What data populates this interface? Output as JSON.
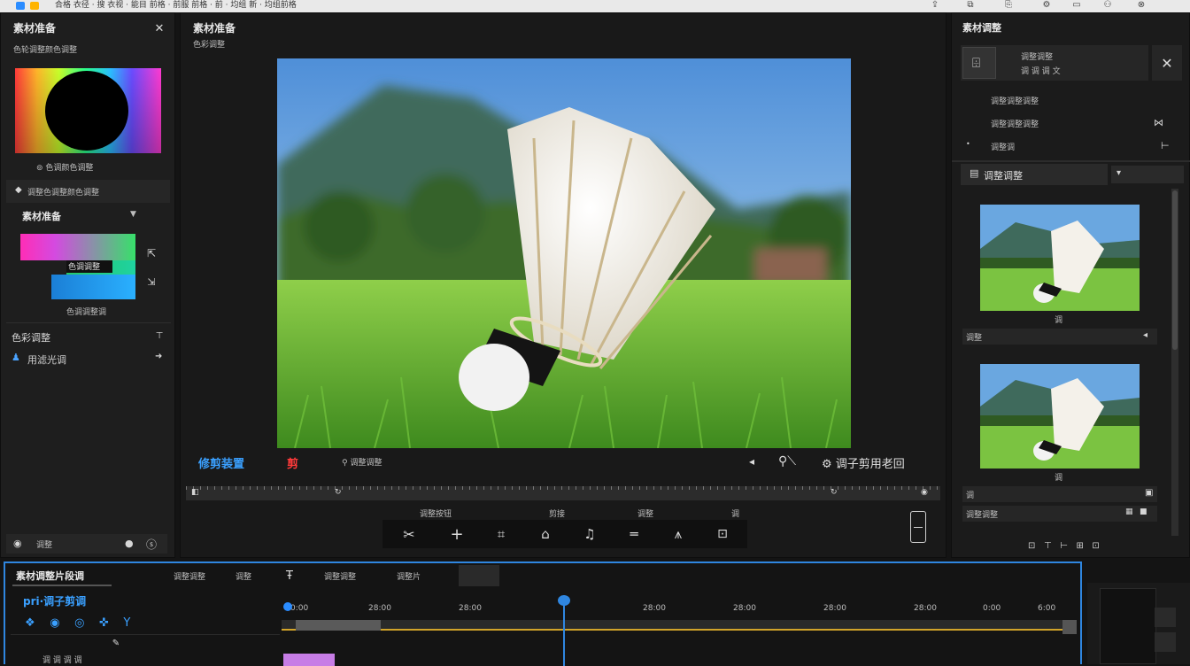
{
  "topbar": {
    "title": "合格 衣径 · 搜 衣视 · 能目 前格 · 前服 前格 · 前 · 均组 新 · 均组前格",
    "icons": [
      "minimize-icon",
      "maximize-icon",
      "share-icon",
      "gear-icon",
      "window-icon",
      "user-icon",
      "close-icon"
    ]
  },
  "left_panel": {
    "title": "素材准备",
    "subtitle": "色轮调整颜色调整",
    "color_wheel_caption": "色调颜色调整",
    "dropdown_label": "调整色调整颜色调整",
    "section2_title": "素材准备",
    "section2_badge": "▼",
    "gradient_caption_top": "色调调整",
    "gradient_caption_bottom": "色调调整调",
    "side_icon_1": "⇱",
    "side_icon_2": "⇲",
    "section3_title": "色彩调整",
    "section3_item": "用滤光调",
    "bottom_label": "调整",
    "colors": {
      "wheel_center": "#000000",
      "gradient_top": "#ff2db6",
      "gradient_mid": "#37e06a",
      "gradient_bottom": "#2a8cff"
    }
  },
  "center_panel": {
    "title": "素材准备",
    "subtitle": "色彩调整",
    "preview_alt": "badminton shuttlecock on grass",
    "label_left": "修剪装置",
    "label_red": "剪",
    "label_mid": "调整调整",
    "label_right": "调子剪用老回",
    "scrubber_left": "0",
    "scrubber_marks": [
      "",
      ""
    ],
    "tool_labels": [
      "调整按钮",
      "剪接",
      "调整",
      "调"
    ],
    "tools": [
      "cut-tool-icon",
      "add-icon",
      "crop-icon",
      "house-icon",
      "audio-icon",
      "line-icon",
      "up-arrow-icon",
      "zoom-icon"
    ]
  },
  "right_panel": {
    "title": "素材调整",
    "item_title": "调整调整",
    "item_sub": "调 调 调 文",
    "rows": [
      {
        "label": "调整调整调整",
        "icon": ""
      },
      {
        "label": "调整调整调整",
        "icon": "⋈"
      },
      {
        "label": "调整调",
        "icon": "⊢"
      }
    ],
    "section_title": "调整调整",
    "section_dropdown": "▾",
    "thumbs": [
      {
        "caption": "调",
        "bar_label": "调整",
        "bar_icon": "◂"
      },
      {
        "caption": "调",
        "bar_label": "调",
        "bar_icon": "▣"
      }
    ],
    "bottom_row_label": "调整调整",
    "bottom_icons": [
      "⊡",
      "⊤",
      "⊢",
      "⊞",
      "⊡"
    ]
  },
  "timeline": {
    "title": "素材调整片段调",
    "tabs": [
      "调整调整",
      "调整",
      "调整调整",
      "调整片"
    ],
    "subtitle": "pri·调子剪调",
    "timecodes": [
      "0:00",
      "28:00",
      "28:00",
      "28:00",
      "28:00",
      "28:00",
      "28:00",
      "0:00",
      "6:00"
    ],
    "playhead_label": "",
    "clip_color": "#c77de6",
    "track_label": "调 调 调 调"
  },
  "colors": {
    "accent": "#2a8cff",
    "selection": "#3a9fff",
    "timeline_border": "#2f86e0"
  }
}
